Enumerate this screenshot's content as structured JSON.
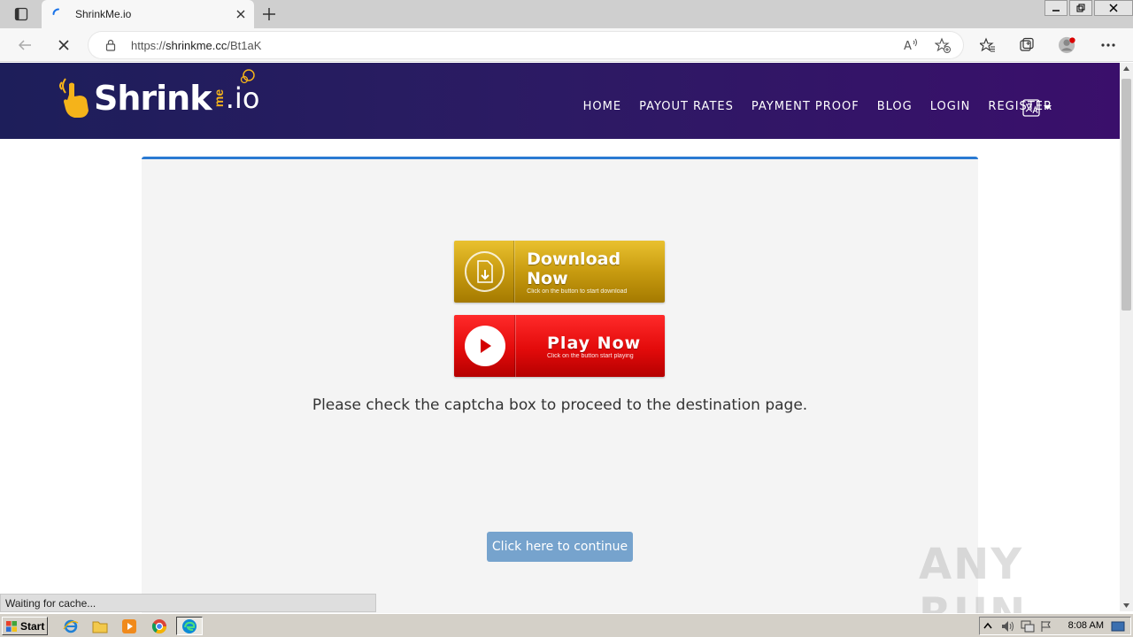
{
  "browser": {
    "tab_title": "ShrinkMe.io",
    "url_prefix": "https://",
    "url_host": "shrinkme.cc",
    "url_path": "/Bt1aK"
  },
  "site": {
    "logo_text": "Shrink",
    "logo_me": "me",
    "logo_io": ".io",
    "nav": [
      "HOME",
      "PAYOUT RATES",
      "PAYMENT PROOF",
      "BLOG",
      "LOGIN",
      "REGISTER"
    ]
  },
  "content": {
    "download_label": "Download Now",
    "download_sub": "Click on the button to start download",
    "play_label": "Play Now",
    "play_sub": "Click on the button start playing",
    "captcha_message": "Please check the captcha box to proceed to the destination page.",
    "continue_label": "Click here to continue"
  },
  "status_text": "Waiting for cache...",
  "watermark": "ANY RUN",
  "taskbar": {
    "start_label": "Start",
    "clock": "8:08 AM"
  },
  "colors": {
    "header_start": "#1d1e5a",
    "header_end": "#3a0f6b",
    "card_accent": "#2a7ad2",
    "continue_button": "#76a3cd",
    "logo_accent": "#f5b31a"
  }
}
